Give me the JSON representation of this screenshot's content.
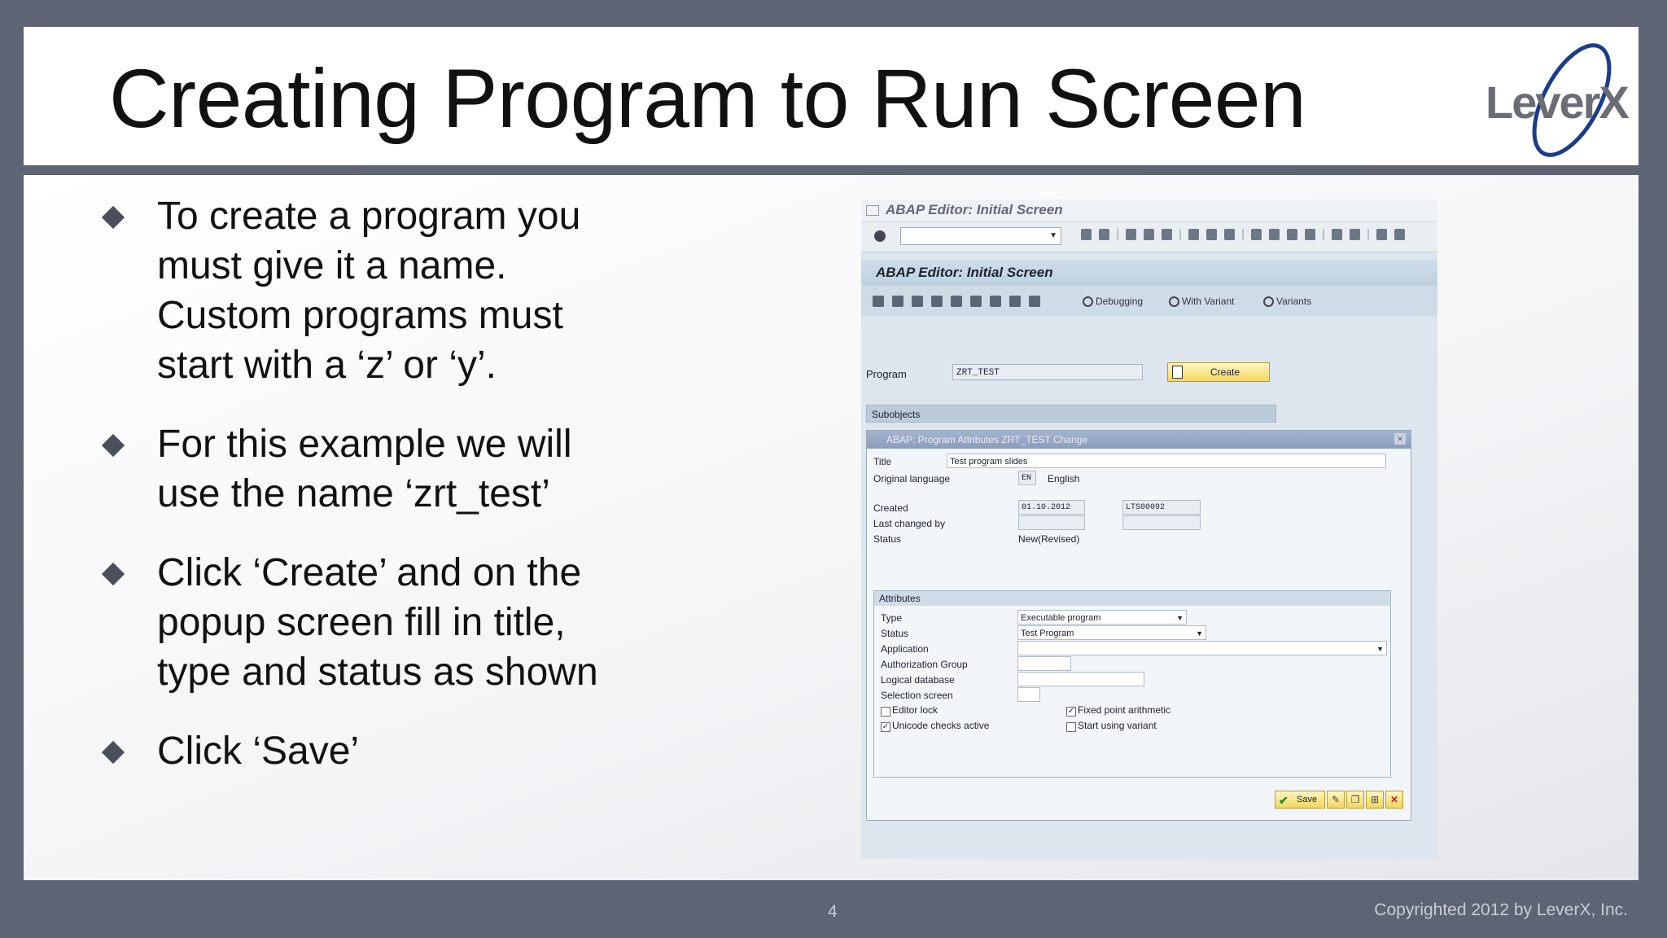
{
  "slide": {
    "title": "Creating Program to Run Screen",
    "logo_text": "LeverX",
    "page_number": "4",
    "copyright": "Copyrighted 2012 by LeverX, Inc.",
    "colors": {
      "background": "#5e6474",
      "logo_text": "#6a6d74",
      "logo_accent": "#1c3c8a"
    }
  },
  "bullets": [
    {
      "text": "To create a program you must give it a name. Custom programs must start with a ‘z’ or ‘y’."
    },
    {
      "text": "For this example we will use the name ‘zrt_test’"
    },
    {
      "text": "Click ‘Create’ and on the popup screen fill in title, type and status as shown"
    },
    {
      "text": "Click ‘Save’"
    }
  ],
  "sap_screenshot": {
    "window_title": "ABAP Editor: Initial Screen",
    "screen_title": "ABAP Editor: Initial Screen",
    "toolbar_buttons": [
      "Debugging",
      "With Variant",
      "Variants"
    ],
    "program_label": "Program",
    "program_value": "ZRT_TEST",
    "create_label": "Create",
    "subobjects_label": "Subobjects",
    "popup": {
      "title": "ABAP: Program Attributes ZRT_TEST Change",
      "title_label": "Title",
      "title_value": "Test program slides",
      "orig_lang_label": "Original language",
      "orig_lang_code": "EN",
      "orig_lang_name": "English",
      "created_label": "Created",
      "created_date": "01.10.2012",
      "created_by": "LTS00092",
      "last_changed_label": "Last changed by",
      "status_label": "Status",
      "status_value": "New(Revised)",
      "attributes_label": "Attributes",
      "type_label": "Type",
      "type_value": "Executable program",
      "attr_status_label": "Status",
      "attr_status_value": "Test Program",
      "application_label": "Application",
      "auth_group_label": "Authorization Group",
      "logical_db_label": "Logical database",
      "selection_screen_label": "Selection screen",
      "editor_lock_label": "Editor lock",
      "unicode_label": "Unicode checks active",
      "fixed_point_label": "Fixed point arithmetic",
      "start_variant_label": "Start using variant",
      "save_label": "Save"
    }
  }
}
